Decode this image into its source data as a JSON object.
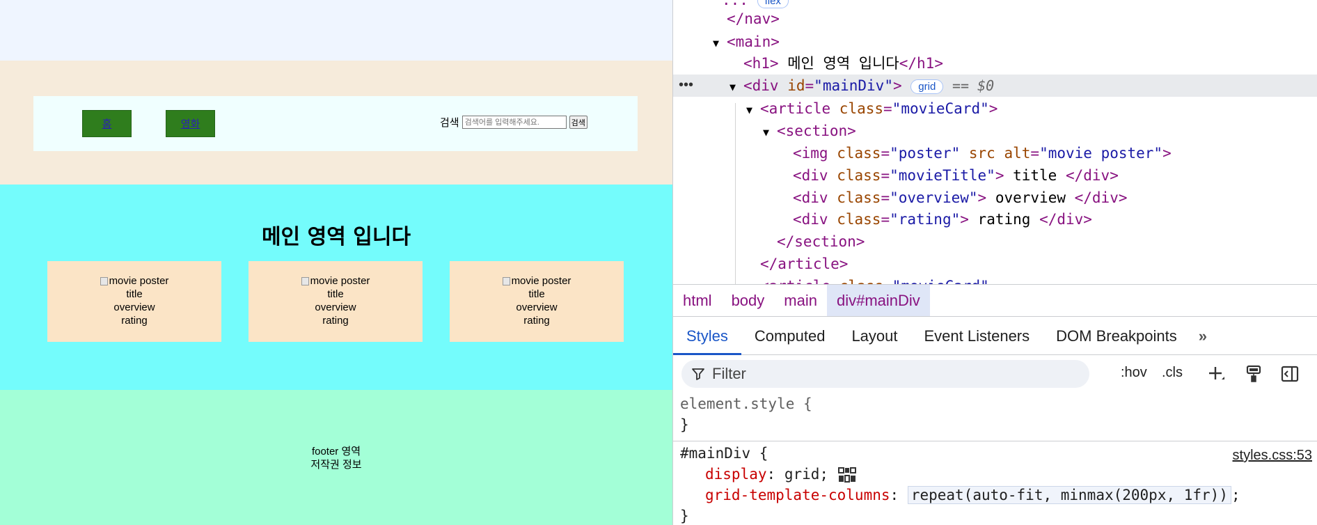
{
  "page": {
    "nav": {
      "home": "홈",
      "movie": "영화"
    },
    "search": {
      "label": "검색",
      "placeholder": "검색어를 입력해주세요.",
      "button": "검색"
    },
    "main_title": "메인 영역 입니다",
    "cards": [
      {
        "alt": "movie poster",
        "title": "title",
        "overview": "overview",
        "rating": "rating"
      },
      {
        "alt": "movie poster",
        "title": "title",
        "overview": "overview",
        "rating": "rating"
      },
      {
        "alt": "movie poster",
        "title": "title",
        "overview": "overview",
        "rating": "rating"
      }
    ],
    "footer": {
      "line1": "footer 영역",
      "line2": "저작권 정보"
    },
    "colors": {
      "top": "#eff5ff",
      "header": "#f6ebdb",
      "nav": "#f0ffff",
      "navbtn": "#2f7d1d",
      "main": "#74fcfc",
      "card": "#fbe4c6",
      "footer": "#a3ffd7"
    }
  },
  "devtools": {
    "dom": {
      "l0_partial": "...",
      "l0_pill": "flex",
      "nav_close": "</nav>",
      "main_open": "<main>",
      "h1_open": "<h1>",
      "h1_text": " 메인 영역 입니다",
      "h1_close": "</h1>",
      "div_open": "<div ",
      "div_attr": "id",
      "div_val": "\"mainDiv\"",
      "div_end": ">",
      "grid_pill": "grid",
      "eq": "== $0",
      "article_open": "<article ",
      "article_attr": "class",
      "article_val": "\"movieCard\"",
      "section_open": "<section>",
      "img_tag": "<img ",
      "img_attr1": "class",
      "img_val1": "\"poster\"",
      "img_attr2": " src alt",
      "img_val2": "\"movie poster\"",
      "div_tag": "<div ",
      "cls": "class",
      "title_val": "\"movieTitle\"",
      "title_text": " title ",
      "overview_val": "\"overview\"",
      "overview_text": " overview ",
      "rating_val": "\"rating\"",
      "rating_text": " rating ",
      "div_close": "</div>",
      "section_close": "</section>",
      "article_close": "</article>"
    },
    "breadcrumbs": [
      "html",
      "body",
      "main",
      "div#mainDiv"
    ],
    "tabs": [
      "Styles",
      "Computed",
      "Layout",
      "Event Listeners",
      "DOM Breakpoints"
    ],
    "filter_placeholder": "Filter",
    "hov": ":hov",
    "cls": ".cls",
    "rules": {
      "element_style": "element.style {",
      "close": "}",
      "selector": "#mainDiv {",
      "source": "styles.css:53",
      "p1_name": "display",
      "p1_value": "grid;",
      "p2_name": "grid-template-columns",
      "p2_value": "repeat(auto-fit, minmax(200px, 1fr))",
      "p2_semicolon": ";"
    }
  }
}
